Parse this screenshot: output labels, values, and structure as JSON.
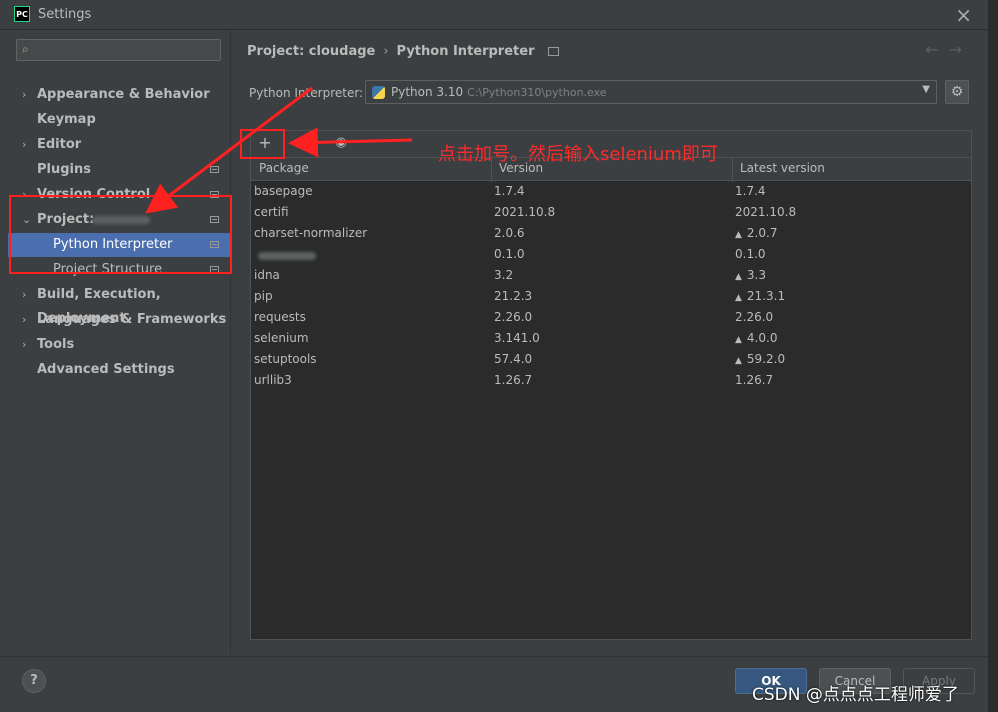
{
  "window": {
    "title": "Settings",
    "app_icon": "PC"
  },
  "search": {
    "placeholder": ""
  },
  "sidebar": {
    "items": [
      {
        "label": "Appearance & Behavior",
        "expandable": true
      },
      {
        "label": "Keymap",
        "expandable": false
      },
      {
        "label": "Editor",
        "expandable": true
      },
      {
        "label": "Plugins",
        "expandable": false
      },
      {
        "label": "Version Control",
        "expandable": true
      },
      {
        "label": "Project:",
        "expandable": true,
        "expanded": true
      },
      {
        "label": "Python Interpreter",
        "selected": true
      },
      {
        "label": "Project Structure"
      },
      {
        "label": "Build, Execution, Deployment",
        "expandable": true
      },
      {
        "label": "Languages & Frameworks",
        "expandable": true
      },
      {
        "label": "Tools",
        "expandable": true
      },
      {
        "label": "Advanced Settings",
        "expandable": false
      }
    ]
  },
  "breadcrumb": {
    "project": "Project: cloudage",
    "page": "Python Interpreter"
  },
  "interpreter": {
    "label": "Python Interpreter:",
    "name": "Python 3.10",
    "path": "C:\\Python310\\python.exe"
  },
  "toolbar": {
    "add": "+",
    "remove": "−",
    "show": "◉"
  },
  "table": {
    "headers": [
      "Package",
      "Version",
      "Latest version"
    ],
    "rows": [
      {
        "package": "basepage",
        "version": "1.7.4",
        "latest": "1.7.4",
        "upgrade": false
      },
      {
        "package": "certifi",
        "version": "2021.10.8",
        "latest": "2021.10.8",
        "upgrade": false
      },
      {
        "package": "charset-normalizer",
        "version": "2.0.6",
        "latest": "2.0.7",
        "upgrade": true
      },
      {
        "package": "",
        "version": "0.1.0",
        "latest": "0.1.0",
        "upgrade": false,
        "blurred": true
      },
      {
        "package": "idna",
        "version": "3.2",
        "latest": "3.3",
        "upgrade": true
      },
      {
        "package": "pip",
        "version": "21.2.3",
        "latest": "21.3.1",
        "upgrade": true
      },
      {
        "package": "requests",
        "version": "2.26.0",
        "latest": "2.26.0",
        "upgrade": false
      },
      {
        "package": "selenium",
        "version": "3.141.0",
        "latest": "4.0.0",
        "upgrade": true
      },
      {
        "package": "setuptools",
        "version": "57.4.0",
        "latest": "59.2.0",
        "upgrade": true
      },
      {
        "package": "urllib3",
        "version": "1.26.7",
        "latest": "1.26.7",
        "upgrade": false
      }
    ]
  },
  "annotation": {
    "text": "点击加号。然后输入selenium即可",
    "color": "#ff2a2a"
  },
  "footer": {
    "help": "?",
    "ok": "OK",
    "cancel": "Cancel",
    "apply": "Apply"
  },
  "watermark": "CSDN @点点点工程师爱了",
  "colors": {
    "selection": "#4b6eaf",
    "background": "#3c3f41",
    "annotation_red": "#ff2020"
  }
}
